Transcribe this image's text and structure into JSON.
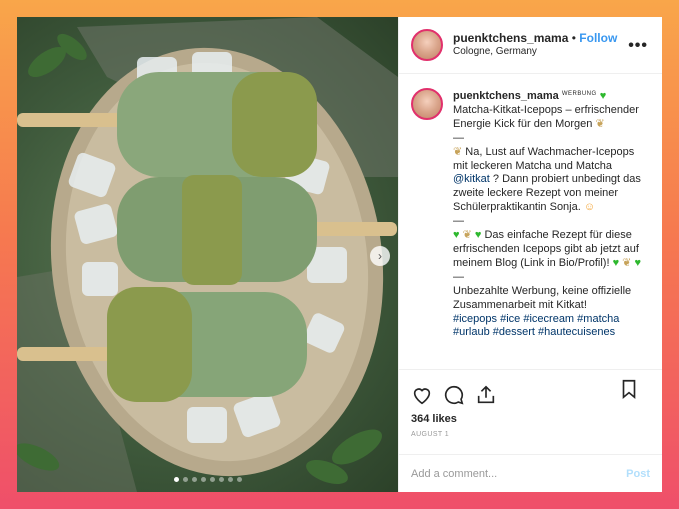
{
  "post": {
    "header": {
      "username": "puenktchens_mama",
      "separator": "•",
      "follow_label": "Follow",
      "location": "Cologne, Germany",
      "more_label": "•••"
    },
    "caption": {
      "username": "puenktchens_mama",
      "ad_label": "WERBUNG",
      "title": "Matcha-Kitkat-Icepops – erfrischender Energie Kick für den Morgen",
      "p1_text": "Na, Lust auf Wachmacher-Icepops mit leckeren Matcha und Matcha",
      "p1_tag": "@kitkat",
      "p1_rest": "? Dann probiert unbedingt das zweite leckere Rezept von meiner Schülerpraktikantin Sonja.",
      "dash": "—",
      "p2_text": "Das einfache Rezept für diese erfrischenden Icepops gibt ab jetzt auf meinem Blog (Link in Bio/Profil)!",
      "p3_text": "Unbezahlte Werbung, keine offizielle Zusammenarbeit mit Kitkat!",
      "hashtags": [
        "#icepops",
        "#ice",
        "#icecream",
        "#matcha",
        "#urlaub",
        "#dessert",
        "#hautecuisenes"
      ]
    },
    "likes": "364 likes",
    "date": "AUGUST 1",
    "comment_placeholder": "Add a comment...",
    "post_label": "Post",
    "carousel": {
      "total": 8,
      "active": 0,
      "next_label": "›"
    },
    "icons": [
      "heart-icon",
      "comment-icon",
      "share-icon",
      "bookmark-icon"
    ],
    "colors": {
      "link": "#3897f0",
      "hashtag": "#003569",
      "post_disabled": "#b2dffc"
    }
  }
}
